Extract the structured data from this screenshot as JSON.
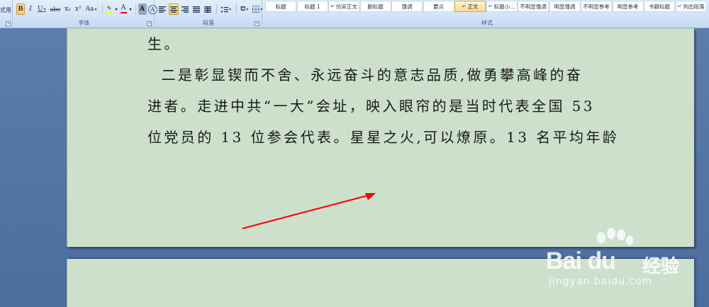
{
  "ribbon": {
    "left_stub_text": "式用",
    "font_group": {
      "label": "字体",
      "buttons": [
        "B",
        "I",
        "U",
        "abe",
        "x₂",
        "x²",
        "Aa",
        "A",
        "A",
        "A"
      ]
    },
    "paragraph_group": {
      "label": "段落"
    },
    "styles_group": {
      "label": "样式",
      "tiles": [
        "标题",
        "标题 1",
        "仿宋正文",
        "副标题",
        "强调",
        "要点",
        "正文",
        "标题小...",
        "不明显强调",
        "明显强调",
        "不明显参考",
        "明显参考",
        "书籍标题",
        "列出段落"
      ],
      "selected": "正文"
    },
    "colors": {
      "highlight": "#ffff00",
      "font_color": "#ff0000",
      "active_button": "#ffc95c"
    }
  },
  "document": {
    "lines": [
      "生。",
      "  二是彰显锲而不舍、永远奋斗的意志品质,做勇攀高峰的奋",
      "进者。走进中共“一大”会址，映入眼帘的是当时代表全国 53",
      "位党员的 13 位参会代表。星星之火,可以燎原。13 名平均年龄"
    ],
    "page_color": "#cce0cc",
    "annotation_color": "#ff0000"
  },
  "watermark": {
    "logo_text": "Bai du",
    "brand_cn": "经验",
    "url": "jingyan.baidu.com"
  }
}
